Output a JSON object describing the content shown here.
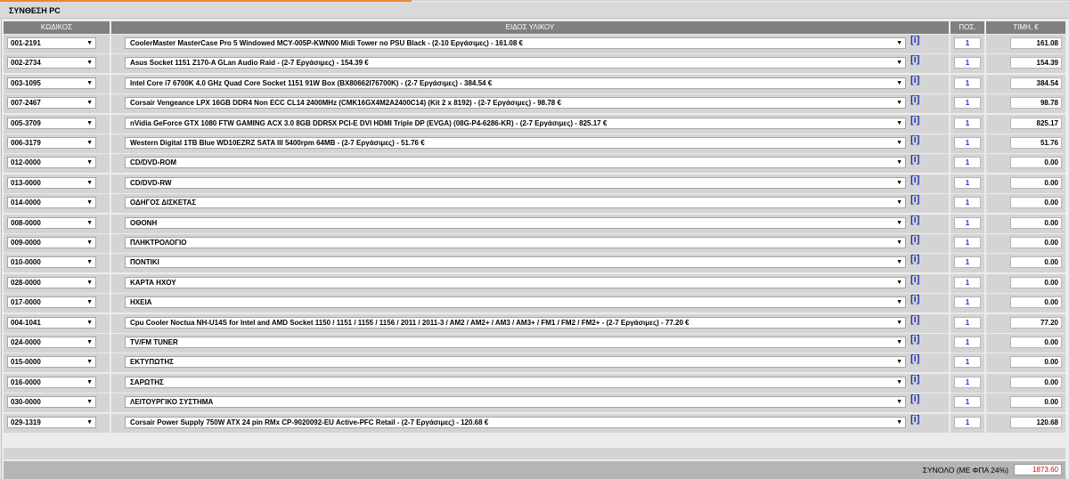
{
  "title": "ΣΥΝΘΕΣΗ PC",
  "headers": {
    "code": "ΚΩΔΙΚΟΣ",
    "desc": "ΕΙΔΟΣ ΥΛΙΚΟΥ",
    "qty": "ΠΟΣ.",
    "price": "ΤΙΜΗ, €"
  },
  "info_label": "[i]",
  "rows": [
    {
      "code": "001-2191",
      "desc": "CoolerMaster MasterCase Pro 5 Windowed MCY-005P-KWN00 Midi Tower no PSU Black - (2-10 Εργάσιμες) - 161.08 €",
      "qty": "1",
      "price": "161.08"
    },
    {
      "code": "002-2734",
      "desc": "Asus Socket 1151 Z170-A GLan Audio Raid - (2-7 Εργάσιμες) - 154.39 €",
      "qty": "1",
      "price": "154.39"
    },
    {
      "code": "003-1095",
      "desc": "Intel Core i7 6700K 4.0 GHz Quad Core Socket 1151 91W Box (BX80662I76700K) - (2-7 Εργάσιμες) - 384.54 €",
      "qty": "1",
      "price": "384.54"
    },
    {
      "code": "007-2467",
      "desc": "Corsair Vengeance LPX 16GB DDR4 Non ECC CL14 2400MHz (CMK16GX4M2A2400C14) (Kit 2 x 8192) - (2-7 Εργάσιμες) - 98.78 €",
      "qty": "1",
      "price": "98.78"
    },
    {
      "code": "005-3709",
      "desc": "nVidia GeForce GTX 1080 FTW GAMING ACX 3.0 8GB DDR5X PCI-E DVI HDMI Triple DP (EVGA) (08G-P4-6286-KR) - (2-7 Εργάσιμες) - 825.17 €",
      "qty": "1",
      "price": "825.17"
    },
    {
      "code": "006-3179",
      "desc": "Western Digital 1TB Blue WD10EZRZ SATA III 5400rpm 64MB - (2-7 Εργάσιμες) - 51.76 €",
      "qty": "1",
      "price": "51.76"
    },
    {
      "code": "012-0000",
      "desc": "CD/DVD-ROM",
      "qty": "1",
      "price": "0.00"
    },
    {
      "code": "013-0000",
      "desc": "CD/DVD-RW",
      "qty": "1",
      "price": "0.00"
    },
    {
      "code": "014-0000",
      "desc": "ΟΔΗΓΟΣ ΔΙΣΚΕΤΑΣ",
      "qty": "1",
      "price": "0.00"
    },
    {
      "code": "008-0000",
      "desc": "ΟΘΟΝΗ",
      "qty": "1",
      "price": "0.00"
    },
    {
      "code": "009-0000",
      "desc": "ΠΛΗΚΤΡΟΛΟΓΙΟ",
      "qty": "1",
      "price": "0.00"
    },
    {
      "code": "010-0000",
      "desc": "ΠΟΝΤΙΚΙ",
      "qty": "1",
      "price": "0.00"
    },
    {
      "code": "028-0000",
      "desc": "ΚΑΡΤΑ ΗΧΟΥ",
      "qty": "1",
      "price": "0.00"
    },
    {
      "code": "017-0000",
      "desc": "ΗΧΕΙΑ",
      "qty": "1",
      "price": "0.00"
    },
    {
      "code": "004-1041",
      "desc": "Cpu Cooler Noctua NH-U14S for Intel and AMD Socket 1150 / 1151 / 1155 / 1156 / 2011 / 2011-3 / AM2 / AM2+ / AM3 / AM3+ / FM1 / FM2 / FM2+ - (2-7 Εργάσιμες) - 77.20 €",
      "qty": "1",
      "price": "77.20"
    },
    {
      "code": "024-0000",
      "desc": "TV/FM TUNER",
      "qty": "1",
      "price": "0.00"
    },
    {
      "code": "015-0000",
      "desc": "ΕΚΤΥΠΩΤΗΣ",
      "qty": "1",
      "price": "0.00"
    },
    {
      "code": "016-0000",
      "desc": "ΣΑΡΩΤΗΣ",
      "qty": "1",
      "price": "0.00"
    },
    {
      "code": "030-0000",
      "desc": "ΛΕΙΤΟΥΡΓΙΚΟ ΣΥΣΤΗΜΑ",
      "qty": "1",
      "price": "0.00"
    },
    {
      "code": "029-1319",
      "desc": "Corsair Power Supply 750W ATX 24 pin RMx CP-9020092-EU Active-PFC Retail - (2-7 Εργάσιμες) - 120.68 €",
      "qty": "1",
      "price": "120.68"
    }
  ],
  "total_label": "ΣΥΝΟΛΟ (ΜΕ ΦΠΑ 24%)",
  "total_value": "1873.60",
  "colors": {
    "accent": "#e98a2b",
    "header": "#808080",
    "link": "#2233bb",
    "total": "#e00000"
  }
}
